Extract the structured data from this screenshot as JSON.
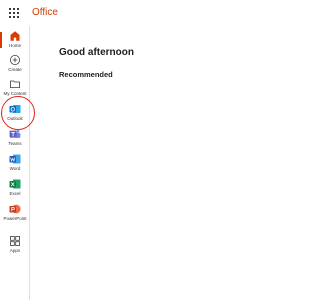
{
  "header": {
    "brand": "Office",
    "launcher_icon": "app-launcher-waffle-icon"
  },
  "rail": {
    "items": [
      {
        "label": "Home",
        "icon": "home-icon",
        "active": true
      },
      {
        "label": "Create",
        "icon": "plus-circle-icon"
      },
      {
        "label": "My Content",
        "icon": "folder-icon"
      },
      {
        "label": "Outlook",
        "icon": "outlook-icon"
      },
      {
        "label": "Teams",
        "icon": "teams-icon"
      },
      {
        "label": "Word",
        "icon": "word-icon"
      },
      {
        "label": "Excel",
        "icon": "excel-icon"
      },
      {
        "label": "PowerPoint",
        "icon": "powerpoint-icon"
      },
      {
        "label": "Apps",
        "icon": "apps-grid-icon"
      }
    ]
  },
  "main": {
    "greeting": "Good afternoon",
    "section_title": "Recommended"
  },
  "colors": {
    "brand": "#d83b01",
    "outlook": "#0f6cbd",
    "teams": "#5b5fc7",
    "word": "#185abd",
    "excel": "#107c41",
    "powerpoint": "#c43e1c",
    "annotation": "#e0241b"
  }
}
